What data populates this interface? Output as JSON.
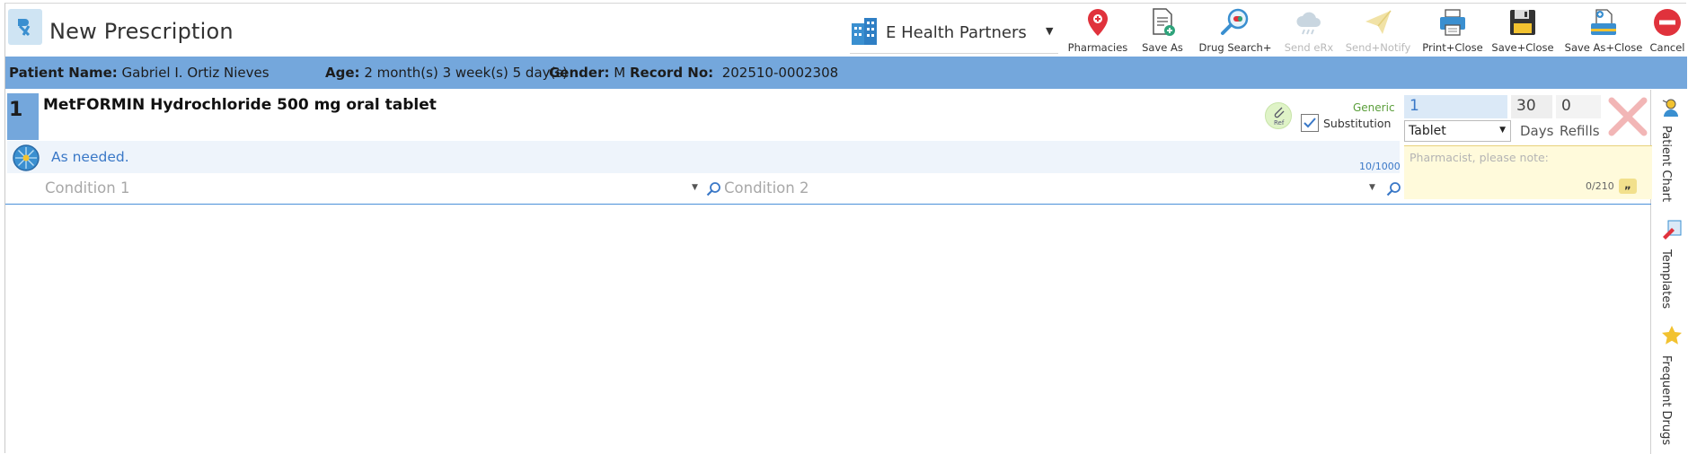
{
  "header": {
    "title": "New Prescription",
    "organization": "E Health Partners"
  },
  "toolbar": {
    "pharmacies": "Pharmacies",
    "save_as": "Save As",
    "drug_search": "Drug Search+",
    "send_erx": "Send eRx",
    "send_notify": "Send+Notify",
    "print_close": "Print+Close",
    "save_close": "Save+Close",
    "save_as_close": "Save As+Close",
    "cancel": "Cancel"
  },
  "patient": {
    "name_label": "Patient Name:",
    "name": "Gabriel I. Ortiz Nieves",
    "age_label": "Age:",
    "age": "2 month(s) 3 week(s) 5 day(s)",
    "gender_label": "Gender:",
    "gender": "M",
    "record_label": "Record No:",
    "record": "202510-0002308"
  },
  "prescription": {
    "number": "1",
    "drug": "MetFORMIN Hydrochloride 500 mg oral tablet",
    "ref_label": "Ref",
    "generic_label": "Generic",
    "substitution_label": "Substitution",
    "substitution_checked": true,
    "quantity": "1",
    "days": "30",
    "refills": "0",
    "unit": "Tablet",
    "days_label": "Days",
    "refills_label": "Refills",
    "sig": "As needed.",
    "sig_count": "10/1000",
    "pharmacist_note_placeholder": "Pharmacist, please note:",
    "pharmacist_note_count": "0/210",
    "quote_glyph": "„",
    "condition1_placeholder": "Condition 1",
    "condition2_placeholder": "Condition 2"
  },
  "side_panel": {
    "patient_chart": "Patient Chart",
    "templates": "Templates",
    "frequent_drugs": "Frequent Drugs"
  },
  "colors": {
    "accent_blue": "#74a7dc",
    "link_blue": "#3a78c7",
    "cancel_red": "#e0323c",
    "generic_green": "#5a9e3a"
  }
}
